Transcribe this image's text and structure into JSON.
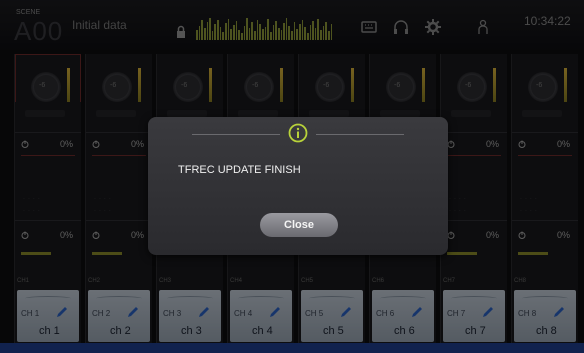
{
  "header": {
    "scene_label": "SCENE",
    "scene_number": "A00",
    "scene_title": "Initial data",
    "clock": "10:34:22"
  },
  "channels": [
    {
      "id": "CH 1",
      "name": "ch 1",
      "knob": "-6",
      "pct_top": "0%",
      "pct_bottom": "0%",
      "meter_label": "CH1"
    },
    {
      "id": "CH 2",
      "name": "ch 2",
      "knob": "-6",
      "pct_top": "0%",
      "pct_bottom": "0%",
      "meter_label": "CH2"
    },
    {
      "id": "CH 3",
      "name": "ch 3",
      "knob": "-6",
      "pct_top": "",
      "pct_bottom": "",
      "meter_label": "CH3"
    },
    {
      "id": "CH 4",
      "name": "ch 4",
      "knob": "-6",
      "pct_top": "",
      "pct_bottom": "",
      "meter_label": "CH4"
    },
    {
      "id": "CH 5",
      "name": "ch 5",
      "knob": "-6",
      "pct_top": "",
      "pct_bottom": "",
      "meter_label": "CH5"
    },
    {
      "id": "CH 6",
      "name": "ch 6",
      "knob": "-6",
      "pct_top": "",
      "pct_bottom": "",
      "meter_label": "CH6"
    },
    {
      "id": "CH 7",
      "name": "ch 7",
      "knob": "-6",
      "pct_top": "0%",
      "pct_bottom": "0%",
      "meter_label": "CH7"
    },
    {
      "id": "CH 8",
      "name": "ch 8",
      "knob": "-6",
      "pct_top": "0%",
      "pct_bottom": "0%",
      "meter_label": "CH8"
    }
  ],
  "dialog": {
    "message": "TFREC UPDATE FINISH",
    "close_label": "Close",
    "icon": "info-icon"
  },
  "icons": [
    "lock-icon",
    "keyboard-icon",
    "headphones-icon",
    "gear-icon",
    "user-icon",
    "pen-icon",
    "power-icon"
  ],
  "colors": {
    "accent_dialog_icon": "#b8d23a",
    "channel_name_bg": "#b5bfcb",
    "bottom_bar": "#1f3f8f"
  }
}
